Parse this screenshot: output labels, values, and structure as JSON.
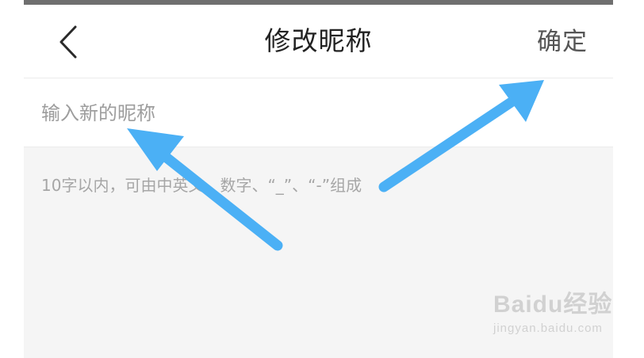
{
  "header": {
    "title": "修改昵称",
    "back_icon": "chevron-left-icon",
    "confirm_label": "确定"
  },
  "form": {
    "nickname_value": "",
    "nickname_placeholder": "输入新的昵称",
    "hint": "10字以内，可由中英文、数字、“_”、“-”组成"
  },
  "watermark": {
    "logo_text": "Baidu经验",
    "url_text": "jingyan.baidu.com"
  },
  "colors": {
    "arrow": "#4bb0f5",
    "background": "#f5f5f5",
    "title_text": "#222222",
    "placeholder_text": "#9d9d9d"
  }
}
